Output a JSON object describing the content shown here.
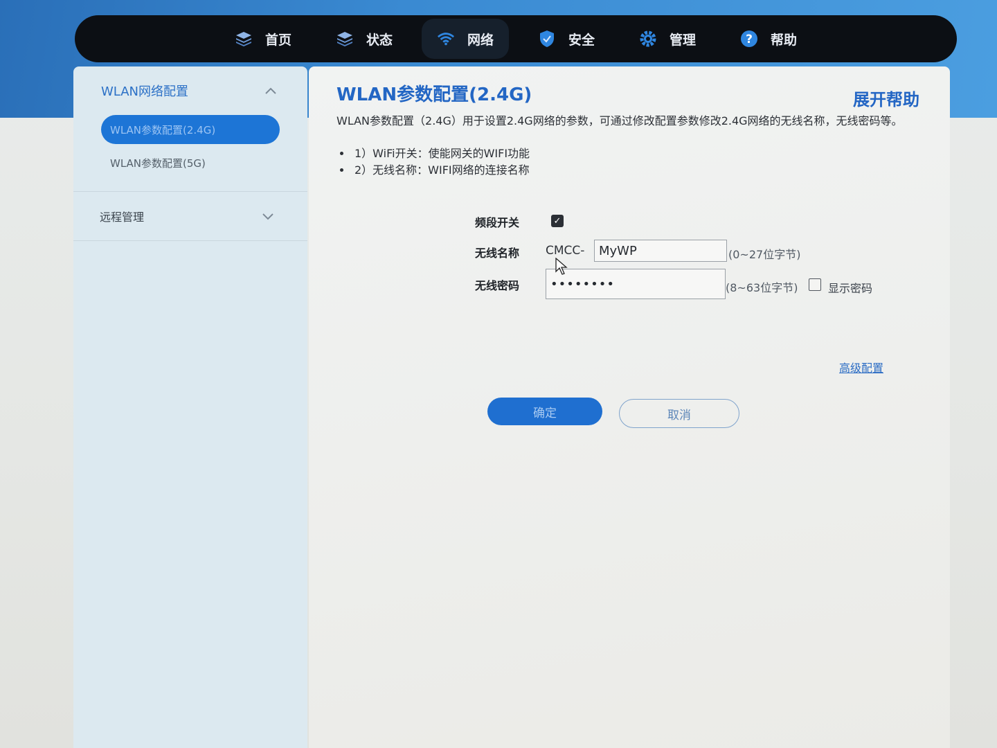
{
  "nav": {
    "items": [
      {
        "label": "首页",
        "icon": "layers-icon"
      },
      {
        "label": "状态",
        "icon": "layers-icon"
      },
      {
        "label": "网络",
        "icon": "wifi-icon",
        "active": true
      },
      {
        "label": "安全",
        "icon": "shield-icon"
      },
      {
        "label": "管理",
        "icon": "gear-icon"
      },
      {
        "label": "帮助",
        "icon": "help-icon"
      }
    ]
  },
  "sidebar": {
    "section_title": "WLAN网络配置",
    "items": [
      {
        "label": "WLAN参数配置(2.4G)",
        "active": true
      },
      {
        "label": "WLAN参数配置(5G)"
      }
    ],
    "group_title": "远程管理"
  },
  "main": {
    "title": "WLAN参数配置(2.4G)",
    "help_link": "展开帮助",
    "description": "WLAN参数配置（2.4G）用于设置2.4G网络的参数，可通过修改配置参数修改2.4G网络的无线名称，无线密码等。",
    "bullets": [
      "1）WiFi开关：使能网关的WIFI功能",
      "2）无线名称：WIFI网络的连接名称"
    ],
    "form": {
      "band_switch_label": "频段开关",
      "band_switch_checked": true,
      "ssid_label": "无线名称",
      "ssid_prefix": "CMCC-",
      "ssid_value": "MyWP",
      "ssid_hint": "(0~27位字节)",
      "password_label": "无线密码",
      "password_value": "••••••••",
      "password_hint": "(8~63位字节)",
      "show_password_label": "显示密码",
      "show_password_checked": false
    },
    "advanced_link": "高级配置",
    "confirm_button": "确定",
    "cancel_button": "取消"
  },
  "colors": {
    "accent": "#1f6fd0",
    "nav_bg": "#0c0f14",
    "sidebar_bg": "#dce9f0"
  }
}
